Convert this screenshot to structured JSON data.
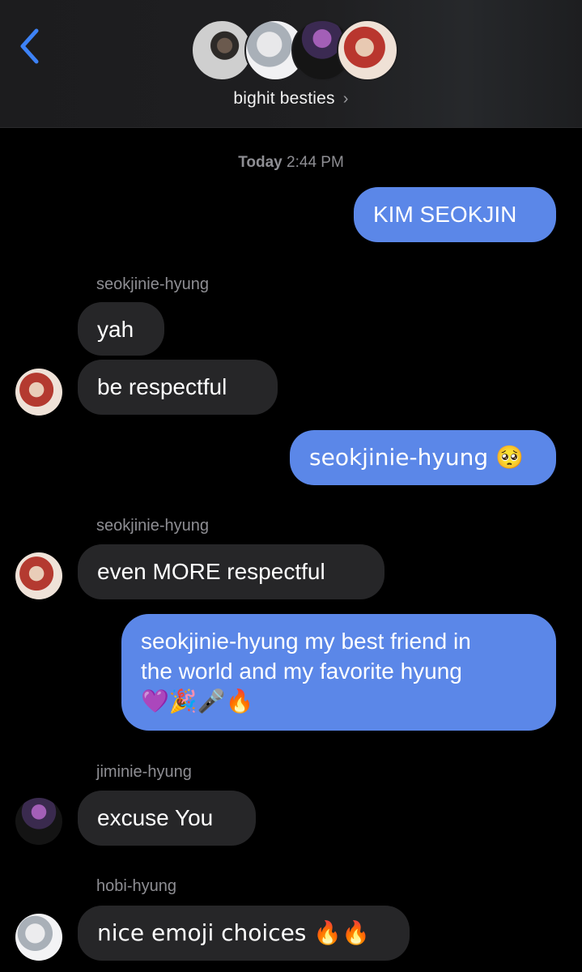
{
  "header": {
    "group_name": "bighit besties",
    "chevron": "›"
  },
  "timestamp": {
    "day": "Today",
    "time": "2:44 PM"
  },
  "messages": [
    {
      "text": "KIM SEOKJIN"
    },
    {
      "sender": "seokjinie-hyung",
      "text": "yah"
    },
    {
      "text": "be respectful"
    },
    {
      "text": "seokjinie-hyung 🥺"
    },
    {
      "sender": "seokjinie-hyung",
      "text": "even MORE respectful"
    },
    {
      "line1": "seokjinie-hyung my best friend in",
      "line2": "the world and my favorite hyung",
      "line3": "💜🎉🎤🔥"
    },
    {
      "sender": "jiminie-hyung",
      "text": "excuse You"
    },
    {
      "sender": "hobi-hyung",
      "text": "nice emoji choices 🔥🔥"
    }
  ],
  "colors": {
    "outgoing": "#5b87e8",
    "incoming": "#262628",
    "back": "#3d82f6"
  }
}
